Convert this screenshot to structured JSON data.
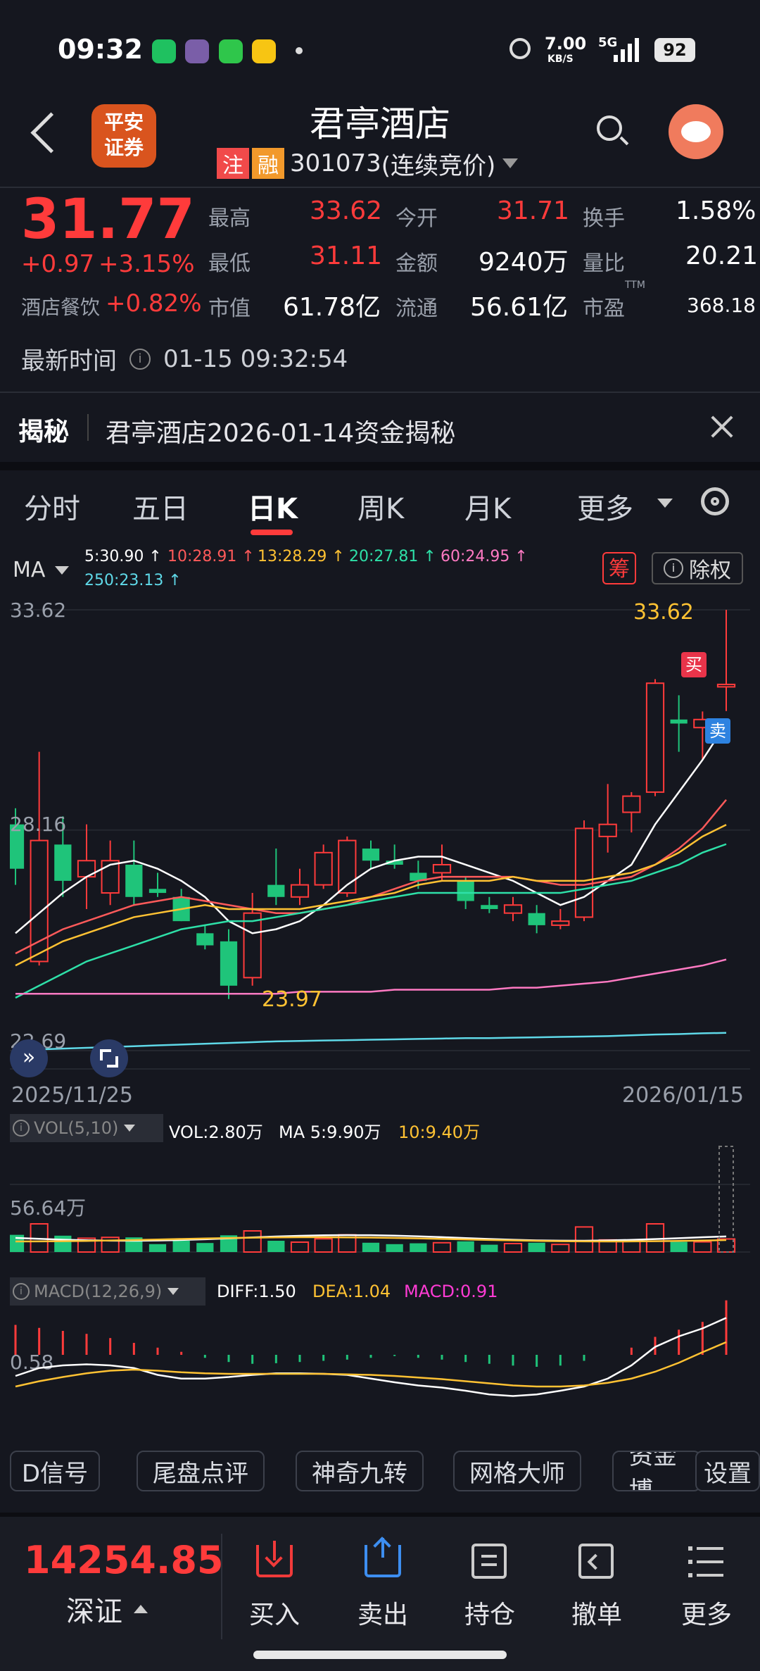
{
  "status_bar": {
    "time": "09:32",
    "net_speed": "7.00",
    "net_unit": "KB/S",
    "net_type": "5G",
    "battery": "92"
  },
  "header": {
    "logo_text_1": "平安",
    "logo_text_2": "证券",
    "title": "君亭酒店",
    "tag_zhu": "注",
    "tag_rong": "融",
    "code": "301073",
    "status": "(连续竞价)"
  },
  "quote": {
    "price": "31.77",
    "change": "+0.97",
    "change_pct": "+3.15%",
    "sector": "酒店餐饮",
    "sector_pct": "+0.82%",
    "stats": [
      {
        "label": "最高",
        "value": "33.62",
        "color": "red"
      },
      {
        "label": "今开",
        "value": "31.71",
        "color": "red"
      },
      {
        "label": "换手",
        "value": "1.58%",
        "color": "white"
      },
      {
        "label": "最低",
        "value": "31.11",
        "color": "red"
      },
      {
        "label": "金额",
        "value": "9240万",
        "color": "white"
      },
      {
        "label": "量比",
        "value": "20.21",
        "color": "white"
      },
      {
        "label": "市值",
        "value": "61.78亿",
        "color": "white"
      },
      {
        "label": "流通",
        "value": "56.61亿",
        "color": "white"
      },
      {
        "label": "市盈",
        "value": "368.18",
        "color": "white",
        "sup": "TTM"
      }
    ],
    "latest_time_label": "最新时间",
    "latest_time": "01-15 09:32:54"
  },
  "banner": {
    "label": "揭秘",
    "text": "君亭酒店2026-01-14资金揭秘"
  },
  "tabs": [
    "分时",
    "五日",
    "日K",
    "周K",
    "月K",
    "更多"
  ],
  "active_tab": "日K",
  "ma_legend": {
    "label": "MA",
    "items": [
      {
        "text": "5:30.90 ↑",
        "color": "#ffffff"
      },
      {
        "text": "10:28.91 ↑",
        "color": "#ff5a5a"
      },
      {
        "text": "13:28.29 ↑",
        "color": "#ffc233"
      },
      {
        "text": "20:27.81 ↑",
        "color": "#2ee0a8"
      },
      {
        "text": "60:24.95 ↑",
        "color": "#ff7ac3"
      },
      {
        "text": "250:23.13 ↑",
        "color": "#5fd9e8"
      }
    ],
    "chip_button": "筹",
    "exright_button": "除权"
  },
  "kline": {
    "y_high": "33.62",
    "y_mid": "28.16",
    "y_low": "22.69",
    "max_label": "33.62",
    "min_label": "23.97",
    "date_start": "2025/11/25",
    "date_end": "2026/01/15",
    "buy_tag": "买",
    "sell_tag": "卖"
  },
  "vol": {
    "label": "VOL(5,10)",
    "vol": "VOL:2.80万",
    "ma5": "MA 5:9.90万",
    "ma10": "10:9.40万",
    "axis": "56.64万"
  },
  "macd": {
    "label": "MACD(12,26,9)",
    "diff": "DIFF:1.50",
    "dea": "DEA:1.04",
    "macd": "MACD:0.91",
    "axis": "0.58"
  },
  "buttons": [
    "D信号",
    "尾盘点评",
    "神奇九转",
    "网格大师",
    "资金博",
    "设置"
  ],
  "bottom": {
    "index_value": "14254.85",
    "index_name": "深证",
    "items": [
      "买入",
      "卖出",
      "持仓",
      "撤单",
      "更多"
    ]
  },
  "chart_data": {
    "type": "candlestick",
    "y_range": [
      22.69,
      33.62
    ],
    "date_start": "2025/11/25",
    "date_end": "2026/01/15",
    "candles": [
      {
        "o": 28.3,
        "h": 28.7,
        "l": 26.8,
        "c": 27.2
      },
      {
        "o": 24.9,
        "h": 30.1,
        "l": 24.8,
        "c": 27.9
      },
      {
        "o": 27.8,
        "h": 28.5,
        "l": 26.5,
        "c": 26.9
      },
      {
        "o": 27.0,
        "h": 28.3,
        "l": 26.2,
        "c": 27.4
      },
      {
        "o": 26.6,
        "h": 27.9,
        "l": 26.3,
        "c": 27.4
      },
      {
        "o": 27.3,
        "h": 27.9,
        "l": 26.3,
        "c": 26.5
      },
      {
        "o": 26.7,
        "h": 27.1,
        "l": 26.5,
        "c": 26.6
      },
      {
        "o": 26.5,
        "h": 26.7,
        "l": 25.9,
        "c": 25.9
      },
      {
        "o": 25.6,
        "h": 25.8,
        "l": 25.2,
        "c": 25.3
      },
      {
        "o": 25.4,
        "h": 25.7,
        "l": 23.97,
        "c": 24.3
      },
      {
        "o": 24.5,
        "h": 26.6,
        "l": 24.3,
        "c": 26.1
      },
      {
        "o": 26.8,
        "h": 27.7,
        "l": 26.3,
        "c": 26.5
      },
      {
        "o": 26.5,
        "h": 27.2,
        "l": 26.3,
        "c": 26.8
      },
      {
        "o": 26.8,
        "h": 27.8,
        "l": 26.7,
        "c": 27.6
      },
      {
        "o": 26.6,
        "h": 28.0,
        "l": 26.5,
        "c": 27.9
      },
      {
        "o": 27.7,
        "h": 27.9,
        "l": 27.2,
        "c": 27.4
      },
      {
        "o": 27.4,
        "h": 27.8,
        "l": 27.2,
        "c": 27.3
      },
      {
        "o": 27.1,
        "h": 27.4,
        "l": 26.7,
        "c": 26.9
      },
      {
        "o": 27.1,
        "h": 27.8,
        "l": 26.9,
        "c": 27.3
      },
      {
        "o": 26.9,
        "h": 27.0,
        "l": 26.2,
        "c": 26.4
      },
      {
        "o": 26.3,
        "h": 26.5,
        "l": 26.1,
        "c": 26.2
      },
      {
        "o": 26.1,
        "h": 26.5,
        "l": 25.9,
        "c": 26.3
      },
      {
        "o": 26.1,
        "h": 26.3,
        "l": 25.6,
        "c": 25.8
      },
      {
        "o": 25.8,
        "h": 26.2,
        "l": 25.7,
        "c": 25.9
      },
      {
        "o": 26.0,
        "h": 28.4,
        "l": 25.9,
        "c": 28.2
      },
      {
        "o": 28.0,
        "h": 29.3,
        "l": 27.6,
        "c": 28.3
      },
      {
        "o": 28.6,
        "h": 29.1,
        "l": 28.1,
        "c": 29.0
      },
      {
        "o": 29.1,
        "h": 31.9,
        "l": 29.0,
        "c": 31.8
      },
      {
        "o": 30.9,
        "h": 31.5,
        "l": 30.1,
        "c": 30.8
      },
      {
        "o": 30.7,
        "h": 31.1,
        "l": 29.9,
        "c": 30.9
      },
      {
        "o": 31.71,
        "h": 33.62,
        "l": 31.11,
        "c": 31.77
      }
    ],
    "ma": [
      {
        "name": "MA5",
        "color": "#ffffff",
        "values": [
          25.6,
          26.1,
          26.6,
          27.0,
          27.3,
          27.4,
          27.2,
          26.9,
          26.5,
          25.9,
          25.6,
          25.7,
          25.9,
          26.3,
          26.8,
          27.2,
          27.4,
          27.5,
          27.5,
          27.3,
          27.1,
          26.9,
          26.6,
          26.3,
          26.5,
          26.9,
          27.3,
          28.3,
          29.1,
          29.9,
          30.8
        ]
      },
      {
        "name": "MA10",
        "color": "#ff5a5a",
        "values": [
          25.1,
          25.4,
          25.7,
          25.9,
          26.1,
          26.3,
          26.4,
          26.5,
          26.4,
          26.3,
          26.2,
          26.1,
          26.1,
          26.2,
          26.3,
          26.5,
          26.7,
          26.9,
          27.0,
          27.0,
          27.0,
          27.0,
          26.9,
          26.8,
          26.8,
          26.9,
          27.0,
          27.3,
          27.7,
          28.2,
          28.91
        ]
      },
      {
        "name": "MA13",
        "color": "#ffc233",
        "values": [
          24.8,
          25.1,
          25.4,
          25.6,
          25.8,
          26.0,
          26.1,
          26.2,
          26.3,
          26.2,
          26.2,
          26.2,
          26.2,
          26.3,
          26.4,
          26.5,
          26.6,
          26.8,
          26.9,
          26.9,
          26.9,
          27.0,
          26.9,
          26.9,
          26.9,
          27.0,
          27.1,
          27.3,
          27.6,
          28.0,
          28.29
        ]
      },
      {
        "name": "MA20",
        "color": "#2ee0a8",
        "values": [
          24.0,
          24.3,
          24.6,
          24.9,
          25.1,
          25.3,
          25.5,
          25.7,
          25.8,
          25.9,
          25.9,
          26.0,
          26.1,
          26.2,
          26.3,
          26.4,
          26.5,
          26.6,
          26.6,
          26.6,
          26.6,
          26.6,
          26.6,
          26.6,
          26.7,
          26.8,
          26.9,
          27.1,
          27.3,
          27.6,
          27.81
        ]
      },
      {
        "name": "MA60",
        "color": "#ff7ac3",
        "values": [
          24.1,
          24.1,
          24.1,
          24.1,
          24.1,
          24.1,
          24.1,
          24.1,
          24.1,
          24.1,
          24.1,
          24.1,
          24.15,
          24.15,
          24.15,
          24.15,
          24.2,
          24.2,
          24.2,
          24.2,
          24.2,
          24.25,
          24.25,
          24.3,
          24.35,
          24.4,
          24.5,
          24.6,
          24.7,
          24.8,
          24.95
        ]
      },
      {
        "name": "MA250",
        "color": "#5fd9e8",
        "values": [
          22.7,
          22.72,
          22.74,
          22.76,
          22.78,
          22.8,
          22.82,
          22.84,
          22.86,
          22.88,
          22.9,
          22.92,
          22.93,
          22.94,
          22.95,
          22.96,
          22.97,
          22.98,
          22.99,
          23.0,
          23.0,
          23.01,
          23.02,
          23.03,
          23.04,
          23.05,
          23.07,
          23.09,
          23.1,
          23.12,
          23.13
        ]
      }
    ]
  }
}
